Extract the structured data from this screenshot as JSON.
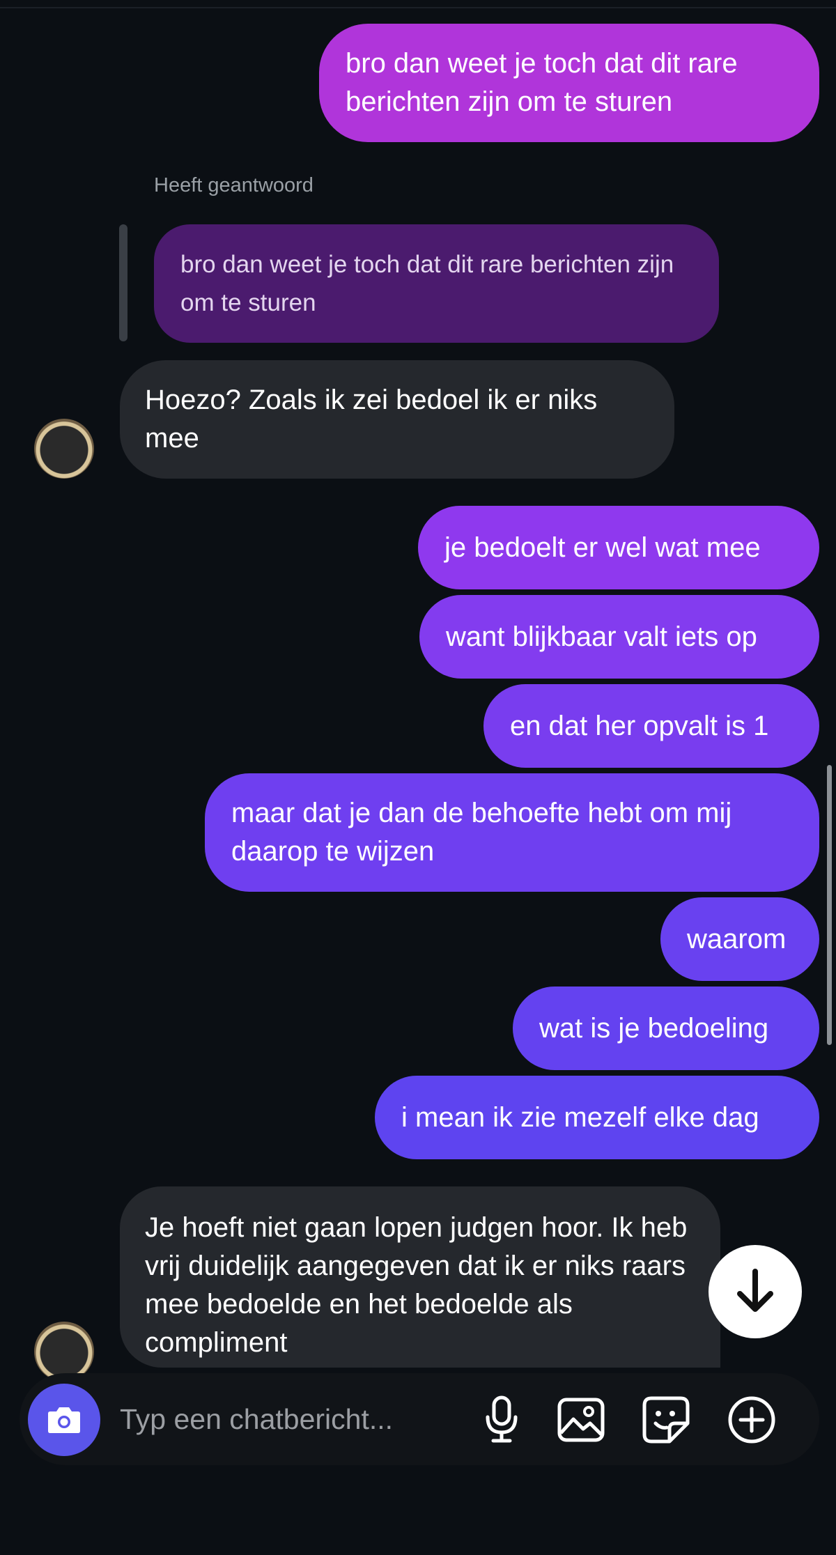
{
  "conversation": {
    "reply_context": {
      "label": "Heeft geantwoord",
      "quoted_text": "bro dan weet je toch dat dit rare berichten zijn om te sturen"
    },
    "messages": [
      {
        "direction": "outgoing",
        "text": "bro dan weet je toch dat dit rare berichten zijn om te sturen"
      },
      {
        "direction": "incoming",
        "text": "Hoezo? Zoals ik zei bedoel ik er niks mee"
      },
      {
        "direction": "outgoing",
        "text": "je bedoelt er wel wat mee"
      },
      {
        "direction": "outgoing",
        "text": "want blijkbaar valt iets op"
      },
      {
        "direction": "outgoing",
        "text": "en dat her opvalt is 1"
      },
      {
        "direction": "outgoing",
        "text": "maar dat je dan de behoefte hebt om mij daarop te wijzen"
      },
      {
        "direction": "outgoing",
        "text": "waarom"
      },
      {
        "direction": "outgoing",
        "text": "wat is je bedoeling"
      },
      {
        "direction": "outgoing",
        "text": "i mean ik zie mezelf elke dag"
      },
      {
        "direction": "incoming",
        "text": "Je hoeft niet gaan lopen judgen hoor. Ik heb vrij duidelijk aangegeven dat ik er niks raars mee bedoelde en het bedoelde als compliment"
      }
    ]
  },
  "composer": {
    "placeholder": "Typ een chatbericht...",
    "icons": [
      "camera-icon",
      "microphone-icon",
      "image-icon",
      "sticker-icon",
      "plus-circle-icon"
    ]
  },
  "scroll_down_icon": "arrow-down-icon",
  "colors": {
    "background": "#0b0f14",
    "incoming_bubble": "#25282d",
    "outgoing_gradient_top": "#b035da",
    "outgoing_gradient_bottom": "#5b45f0",
    "reply_bubble": "#4b1b6e",
    "camera_button": "#5a55ea"
  }
}
